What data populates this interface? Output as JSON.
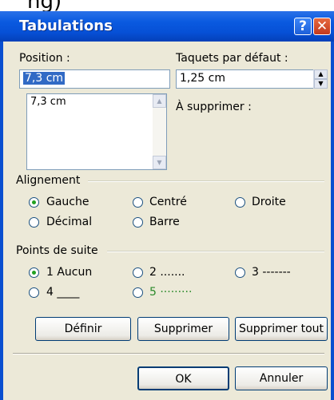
{
  "dialog": {
    "title": "Tabulations"
  },
  "position": {
    "label": "Position :",
    "value": "7,3 cm",
    "list": [
      "7,3 cm"
    ]
  },
  "default_tabs": {
    "label": "Taquets par défaut :",
    "value": "1,25 cm"
  },
  "to_delete": {
    "label": "À supprimer :"
  },
  "alignment": {
    "label": "Alignement",
    "options": [
      {
        "key": "G",
        "label": "Gauche",
        "checked": true
      },
      {
        "key": "C",
        "label": "Centré",
        "checked": false
      },
      {
        "key": "r",
        "label": "Droite",
        "checked": false
      },
      {
        "key": "m",
        "label": "Décimal",
        "checked": false
      },
      {
        "key": "B",
        "label": "Barre",
        "checked": false
      }
    ]
  },
  "leaders": {
    "label": "Points de suite",
    "options": [
      {
        "label": "1 Aucun",
        "checked": true
      },
      {
        "label": "2 .......",
        "checked": false
      },
      {
        "label": "3 -------",
        "checked": false
      },
      {
        "label": "4 ____",
        "checked": false
      },
      {
        "label": "5 ·········",
        "checked": false
      }
    ]
  },
  "buttons": {
    "set": "Définir",
    "clear": "Supprimer",
    "clear_all": "Supprimer tout",
    "ok": "OK",
    "cancel": "Annuler"
  },
  "icons": {
    "help": "help-icon",
    "close": "close-icon",
    "spin_up": "arrow-up-icon",
    "spin_down": "arrow-down-icon"
  },
  "colors": {
    "titlebar": "#0a5ae0",
    "dialog_bg": "#ece9d8",
    "selection": "#316ac5",
    "close_button": "#c2391e"
  }
}
